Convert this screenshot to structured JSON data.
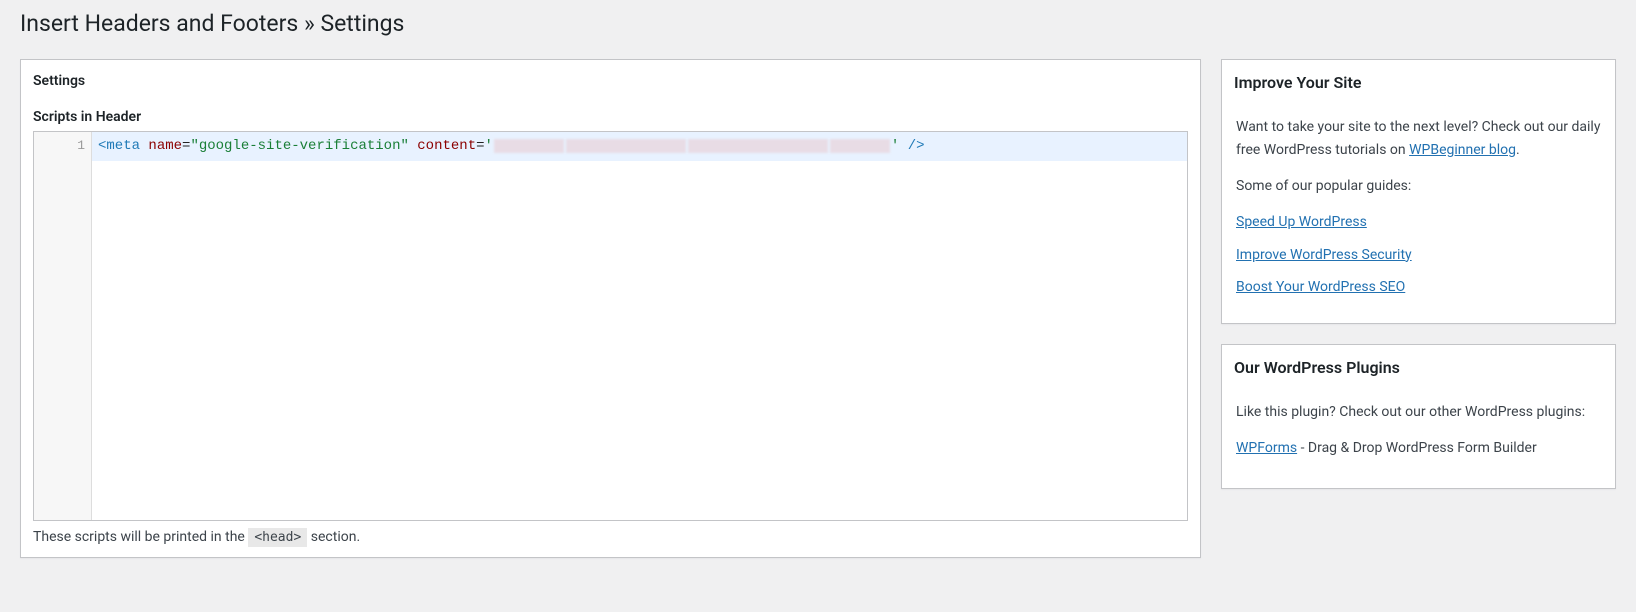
{
  "page": {
    "title": "Insert Headers and Footers » Settings"
  },
  "settings": {
    "heading": "Settings",
    "header_scripts": {
      "label": "Scripts in Header",
      "line_number": "1",
      "code_parts": {
        "open_bracket": "<",
        "tag": "meta",
        "attr_name1": "name",
        "eq": "=",
        "str_name": "\"google-site-verification\"",
        "attr_name2": "content",
        "str_open": "'",
        "str_close": "'",
        "self_close": " />"
      },
      "help_prefix": "These scripts will be printed in the ",
      "help_code": "<head>",
      "help_suffix": " section."
    }
  },
  "sidebar": {
    "improve": {
      "heading": "Improve Your Site",
      "intro_pre": "Want to take your site to the next level? Check out our daily free WordPress tutorials on ",
      "intro_link": "WPBeginner blog",
      "intro_post": ".",
      "popular_label": "Some of our popular guides:",
      "guides": [
        "Speed Up WordPress",
        "Improve WordPress Security",
        "Boost Your WordPress SEO"
      ]
    },
    "plugins": {
      "heading": "Our WordPress Plugins",
      "intro": "Like this plugin? Check out our other WordPress plugins:",
      "item1_link": "WPForms",
      "item1_rest": " - Drag & Drop WordPress Form Builder"
    }
  }
}
